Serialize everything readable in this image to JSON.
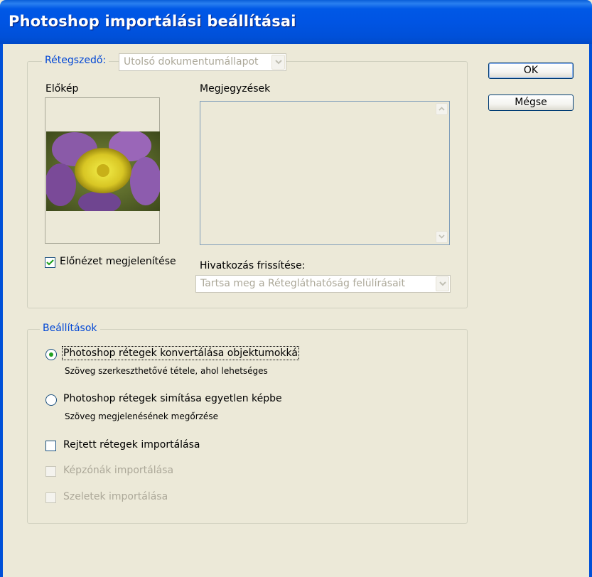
{
  "window": {
    "title": "Photoshop importálási beállításai"
  },
  "buttons": {
    "ok": "OK",
    "cancel": "Mégse"
  },
  "layer_comp": {
    "label": "Rétegszedő:",
    "value": "Utolsó dokumentumállapot",
    "preview_label": "Előkép",
    "notes_label": "Megjegyzések",
    "show_preview_label": "Előnézet megjelenítése",
    "show_preview_checked": true,
    "update_link_label": "Hivatkozás frissítése:",
    "update_link_value": "Tartsa meg a Rétegláthatóság felülírásait"
  },
  "options": {
    "legend": "Beállítások",
    "radio_convert": {
      "label": "Photoshop rétegek konvertálása objektumokká",
      "sub": "Szöveg szerkeszthetővé tétele, ahol lehetséges",
      "selected": true
    },
    "radio_flatten": {
      "label": "Photoshop rétegek simítása egyetlen képbe",
      "sub": "Szöveg megjelenésének megőrzése",
      "selected": false
    },
    "hidden_layers": {
      "label": "Rejtett rétegek importálása",
      "checked": false,
      "enabled": true
    },
    "image_maps": {
      "label": "Képzónák importálása",
      "checked": false,
      "enabled": false
    },
    "slices": {
      "label": "Szeletek importálása",
      "checked": false,
      "enabled": false
    }
  },
  "colors": {
    "titlebar": "#0054e3",
    "dialog_bg": "#ece9d8",
    "group_label": "#0046d5",
    "disabled_text": "#aca899",
    "radio_dot": "#21a121"
  }
}
